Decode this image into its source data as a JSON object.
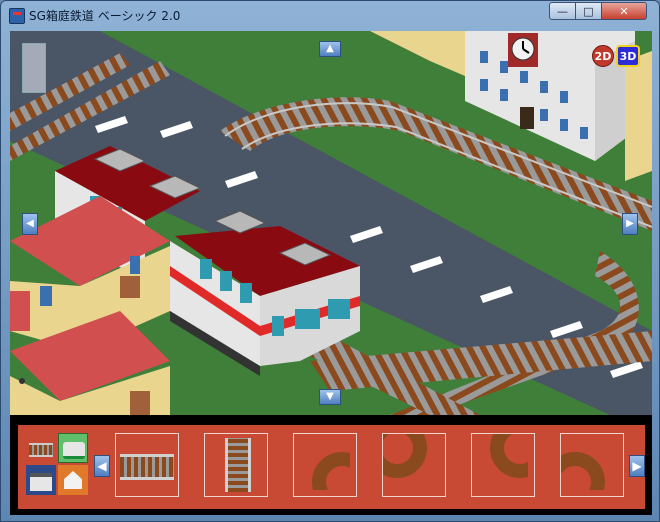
{
  "window": {
    "title": "SG箱庭鉄道 ベーシック 2.0",
    "controls": {
      "minimize": "—",
      "maximize": "□",
      "close": "✕"
    }
  },
  "view": {
    "mode_2d_label": "2D",
    "mode_3d_label": "3D",
    "active_mode": "3D",
    "scroll_up_icon": "chevron-up-icon",
    "scroll_down_icon": "chevron-down-icon",
    "scroll_left_icon": "chevron-left-icon",
    "scroll_right_icon": "chevron-right-icon",
    "building_clock": "clock-icon"
  },
  "palette": {
    "categories": [
      {
        "name": "rail-category",
        "icon": "rail-icon",
        "selected": true
      },
      {
        "name": "train-category",
        "icon": "train-icon",
        "selected": false
      },
      {
        "name": "station-category",
        "icon": "station-icon",
        "selected": false
      },
      {
        "name": "building-category",
        "icon": "house-icon",
        "selected": false
      }
    ],
    "prev_icon": "chevron-left-icon",
    "next_icon": "chevron-right-icon",
    "tiles": [
      {
        "name": "track-straight-horizontal",
        "icon": "straight-rail-horizontal-icon"
      },
      {
        "name": "track-straight-vertical",
        "icon": "straight-rail-vertical-icon"
      },
      {
        "name": "track-curve-bottom-right",
        "icon": "curve-rail-icon"
      },
      {
        "name": "track-curve-bottom-left",
        "icon": "curve-rail-icon"
      },
      {
        "name": "track-curve-top-right",
        "icon": "curve-rail-icon"
      },
      {
        "name": "track-curve-top-left",
        "icon": "curve-rail-icon"
      }
    ]
  },
  "colors": {
    "grass": "#3f7f3a",
    "road": "#4a5565",
    "rail_tie": "#8a4a1e",
    "train_body": "#e6e6e6",
    "train_roof": "#8a0a12",
    "train_stripe": "#e02a2a",
    "house_roof": "#d14f4f",
    "house_wall": "#e9d58e",
    "palette_bg": "#c84a35"
  }
}
